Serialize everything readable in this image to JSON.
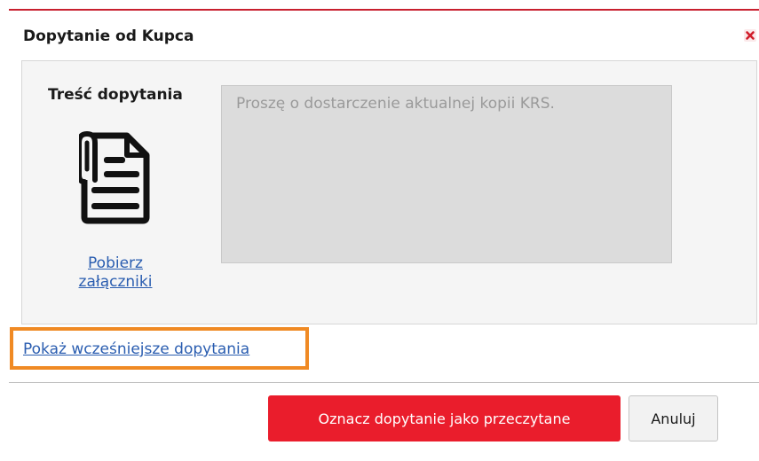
{
  "dialog": {
    "title": "Dopytanie od Kupca",
    "close_icon": "close-icon",
    "accent_color": "#c8202f"
  },
  "content": {
    "label": "Treść dopytania",
    "attachment_icon": "document-attachment-icon",
    "download_link": "Pobierz załączniki",
    "message_text": "Proszę o dostarczenie aktualnej kopii KRS."
  },
  "earlier_link": {
    "label": "Pokaż wcześniejsze dopytania",
    "highlight_color": "#f08a24"
  },
  "buttons": {
    "primary_label": "Oznacz dopytanie jako przeczytane",
    "primary_color": "#ea1d2c",
    "cancel_label": "Anuluj"
  }
}
